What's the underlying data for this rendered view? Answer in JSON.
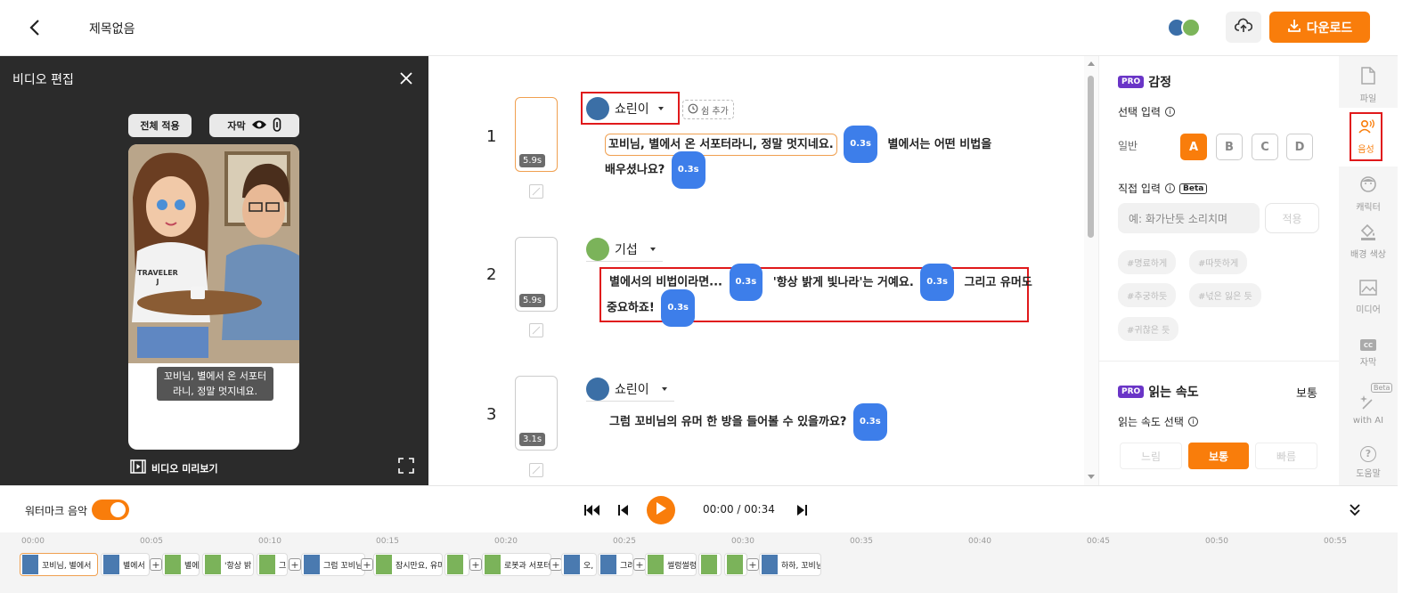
{
  "header": {
    "title": "제목없음",
    "download_label": "다운로드"
  },
  "left_panel": {
    "title": "비디오 편집",
    "apply_all": "전체 적용",
    "subtitle_label": "자막",
    "caption_text_1": "꼬비님, 별에서 온 서포터",
    "caption_text_2": "라니, 정말 멋지네요.",
    "preview_label": "비디오 미리보기",
    "shirt_text_1": "TRAVELER",
    "shirt_text_2": "J"
  },
  "scenes": [
    {
      "num": "1",
      "speaker": "쇼린이",
      "add_pause": "쉼 추가",
      "duration": "5.9s",
      "line1_seg1": "꼬비님, 별에서 온 서포터라니, 정말 멋지네요.",
      "line1_tag1": "0.3s",
      "line1_seg2": "별에서는 어떤 비법을",
      "line2_seg1": "배우셨나요?",
      "line2_tag1": "0.3s"
    },
    {
      "num": "2",
      "speaker": "기섭",
      "duration": "5.9s",
      "line1_seg1": "별에서의 비법이라면...",
      "line1_tag1": "0.3s",
      "line1_seg2": "'항상 밝게 빛나라'는 거예요.",
      "line1_tag2": "0.3s",
      "line1_seg3": "그리고 유머도",
      "line2_seg1": "중요하죠!",
      "line2_tag1": "0.3s"
    },
    {
      "num": "3",
      "speaker": "쇼린이",
      "duration": "3.1s",
      "line1_seg1": "그럼 꼬비님의 유머 한 방을 들어볼 수 있을까요?",
      "line1_tag1": "0.3s"
    }
  ],
  "right_panel": {
    "emotion_title": "감정",
    "pro": "PRO",
    "select_input": "선택 입력",
    "normal": "일반",
    "letters": [
      "A",
      "B",
      "C",
      "D"
    ],
    "direct_input": "직접 입력",
    "beta": "Beta",
    "direct_placeholder": "예: 화가난듯 소리치며",
    "apply": "적용",
    "chips": [
      "#명료하게",
      "#따뜻하게",
      "#추궁하듯",
      "#넋은 잃은 듯",
      "#귀찮은 듯"
    ],
    "speed_title": "읽는 속도",
    "speed_value": "보통",
    "speed_select": "읽는 속도 선택",
    "speed_options": [
      "느림",
      "보통",
      "빠름"
    ]
  },
  "sidebar": [
    {
      "label": "파일",
      "icon": "file-icon"
    },
    {
      "label": "음성",
      "icon": "voice-icon"
    },
    {
      "label": "캐릭터",
      "icon": "character-icon"
    },
    {
      "label": "배경 색상",
      "icon": "paint-bucket-icon"
    },
    {
      "label": "미디어",
      "icon": "media-icon"
    },
    {
      "label": "자막",
      "icon": "caption-icon"
    },
    {
      "label": "with AI",
      "icon": "ai-sparkle-icon",
      "badge": "Beta"
    },
    {
      "label": "도움말",
      "icon": "help-icon"
    }
  ],
  "player": {
    "watermark_music": "워터마크 음악",
    "time": "00:00 / 00:34"
  },
  "timeline": {
    "ticks": [
      "00:00",
      "00:05",
      "00:10",
      "00:15",
      "00:20",
      "00:25",
      "00:30",
      "00:35",
      "00:40",
      "00:45",
      "00:50",
      "00:55"
    ],
    "clips": [
      "꼬비님, 별에서",
      "별에서",
      "별에",
      "'항상 밝",
      "그",
      "그럼 꼬비님",
      "잠시만요, 유머",
      "",
      "로봇과 서포터",
      "오,",
      "그려",
      "썰렁썰렁",
      "",
      "",
      "하하, 꼬비님"
    ]
  },
  "colors": {
    "accent": "#f97d0b",
    "tag_blue": "#3d7eea",
    "pro_purple": "#6a35c7",
    "highlight_red": "#e0191b"
  }
}
